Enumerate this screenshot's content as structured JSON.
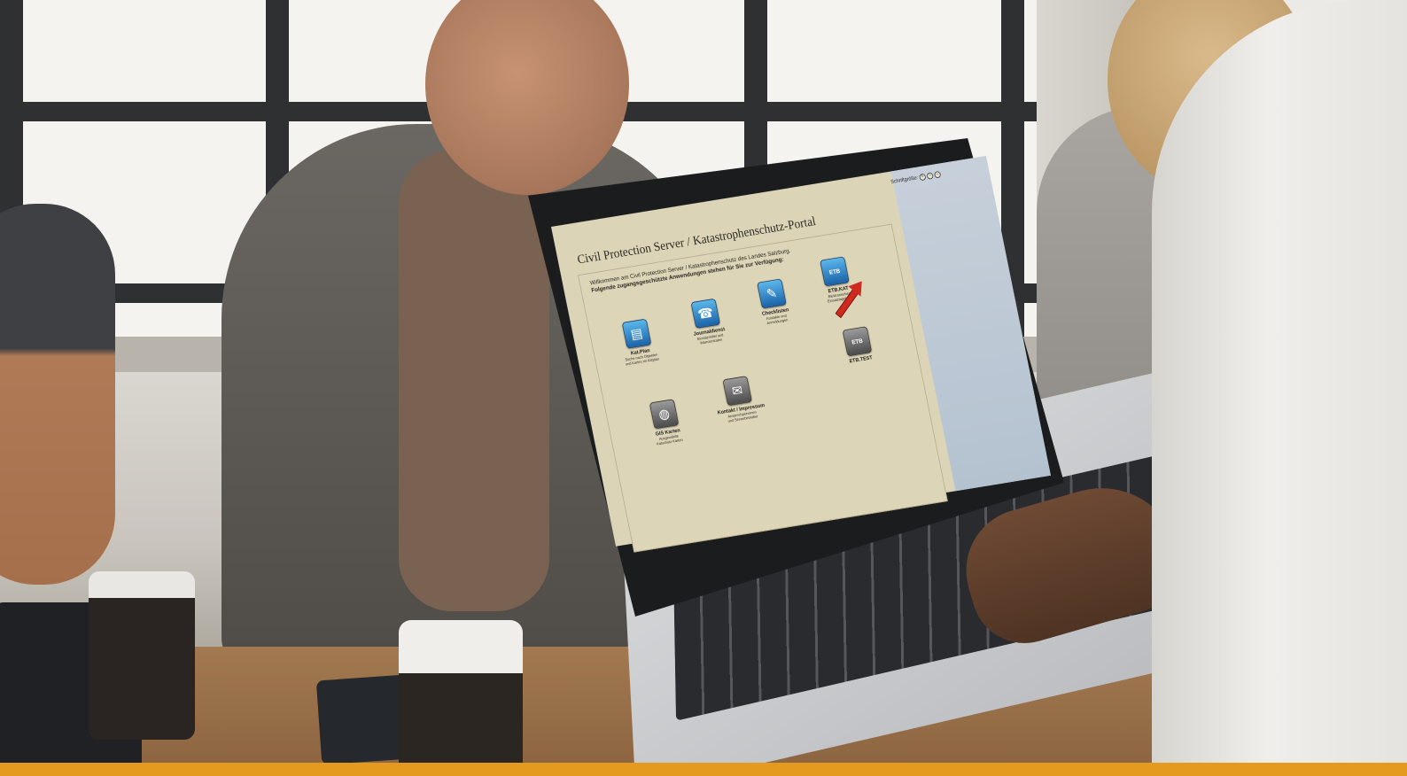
{
  "portal": {
    "title": "Civil Protection Server / Katastrophenschutz-Portal",
    "font_size_label": "Schriftgröße:",
    "font_size_buttons": [
      "+",
      "–",
      "–"
    ],
    "welcome_line1": "Willkommen am Civil Protection Server / Katastrophenschutz des Landes Salzburg.",
    "welcome_line2": "Folgende zugangsgeschützte Anwendungen stehen für Sie zur Verfügung:",
    "apps": [
      {
        "title": "Kat.Plan",
        "sub1": "Suche nach Objekten",
        "sub2": "und Karten im Katplan",
        "icon": "document-icon",
        "glyph": "▤"
      },
      {
        "title": "Journaldienst",
        "sub1": "Einsatzmittel und",
        "sub2": "Warnzentralen",
        "icon": "phone-icon",
        "glyph": "☎"
      },
      {
        "title": "Checklisten",
        "sub1": "Kontakte und",
        "sub2": "Anmeldungen",
        "icon": "clipboard-icon",
        "glyph": "✎"
      },
      {
        "title": "ETB.KAT",
        "sub1": "Elektronisches",
        "sub2": "Einsatztagebuch",
        "icon": "etb-book-icon",
        "glyph": "ETB"
      },
      {
        "title": "GIS Karten",
        "sub1": "Ausgewählte",
        "sub2": "Katschutz-Karten",
        "icon": "globe-icon",
        "glyph": "◍"
      },
      {
        "title": "Kontakt / Impressum",
        "sub1": "Ansprechpersonen",
        "sub2": "und Serverbetreiber",
        "icon": "envelope-icon",
        "glyph": "✉"
      },
      {
        "title": "ETB.TEST",
        "sub1": "",
        "sub2": "",
        "icon": "etb-book-icon",
        "glyph": "ETB"
      }
    ],
    "colors": {
      "screen_bg": "#dcd4b6",
      "side_panel": "#c7d0da",
      "icon_blue": "#1a63a8",
      "icon_gray": "#4c4c4c",
      "arrow_red": "#d02a1f"
    }
  },
  "scene": {
    "accent_strip_color": "#e39a1f"
  }
}
